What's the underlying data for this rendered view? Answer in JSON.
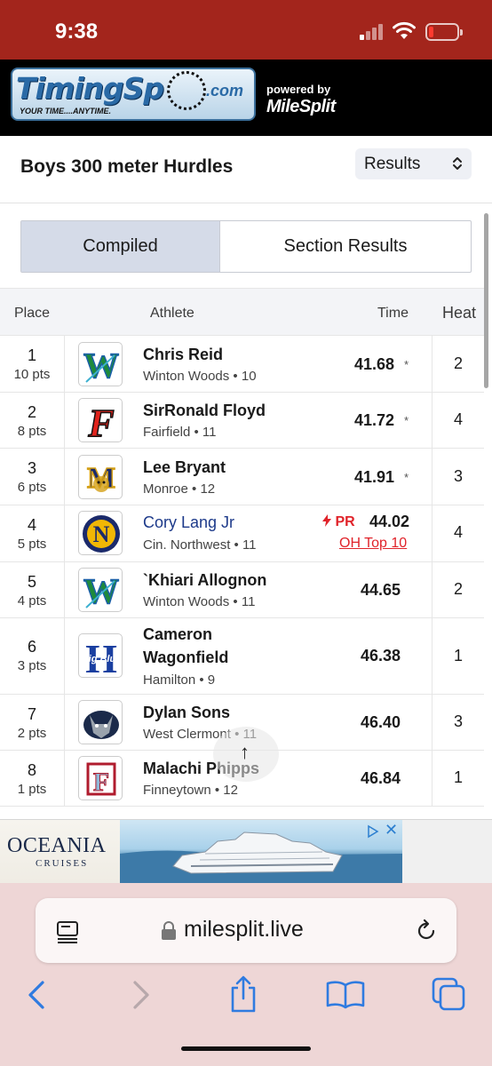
{
  "status": {
    "time": "9:38"
  },
  "header": {
    "logo_text": "TimingSp",
    "logo_com": ".com",
    "logo_tagline": "YOUR TIME....ANYTIME.",
    "powered_by": "powered by",
    "brand": "MileSplit"
  },
  "event": {
    "title": "Boys 300 meter Hurdles",
    "view_select": "Results"
  },
  "tabs": [
    {
      "label": "Compiled"
    },
    {
      "label": "Section Results"
    }
  ],
  "table": {
    "headers": {
      "place": "Place",
      "athlete": "Athlete",
      "time": "Time",
      "heat": "Heat"
    },
    "rows": [
      {
        "place": "1",
        "pts": "10 pts",
        "name": "Chris Reid",
        "school": "Winton Woods • 10",
        "time": "41.68",
        "mark": "*",
        "heat": "2",
        "logo": "winton-woods-logo"
      },
      {
        "place": "2",
        "pts": "8 pts",
        "name": "SirRonald Floyd",
        "school": "Fairfield • 11",
        "time": "41.72",
        "mark": "*",
        "heat": "4",
        "logo": "fairfield-logo"
      },
      {
        "place": "3",
        "pts": "6 pts",
        "name": "Lee Bryant",
        "school": "Monroe • 12",
        "time": "41.91",
        "mark": "*",
        "heat": "3",
        "logo": "monroe-logo"
      },
      {
        "place": "4",
        "pts": "5 pts",
        "name": "Cory Lang Jr",
        "school": "Cin. Northwest • 11",
        "time": "44.02",
        "pr": "PR",
        "rank_link": "OH Top 10",
        "heat": "4",
        "logo": "cin-northwest-logo"
      },
      {
        "place": "5",
        "pts": "4 pts",
        "name": "`Khiari Allognon",
        "school": "Winton Woods • 11",
        "time": "44.65",
        "heat": "2",
        "logo": "winton-woods-logo"
      },
      {
        "place": "6",
        "pts": "3 pts",
        "name_line1": "Cameron",
        "name_line2": "Wagonfield",
        "school": "Hamilton • 9",
        "time": "46.38",
        "heat": "1",
        "logo": "hamilton-logo",
        "logo_text": "Big Blue"
      },
      {
        "place": "7",
        "pts": "2 pts",
        "name": "Dylan Sons",
        "school": "West Clermont • 11",
        "time": "46.40",
        "heat": "3",
        "logo": "west-clermont-logo"
      },
      {
        "place": "8",
        "pts": "1 pts",
        "name": "Malachi Phipps",
        "school": "Finneytown • 12",
        "time": "46.84",
        "heat": "1",
        "logo": "finneytown-logo"
      }
    ]
  },
  "ad": {
    "brand": "OCEANIA",
    "sub": "CRUISES",
    "close": "✕"
  },
  "browser": {
    "url": "milesplit.live"
  },
  "colors": {
    "status_bar": "#a3251c",
    "header": "#000000",
    "accent_red": "#e0232a",
    "link_blue": "#1d3a8a",
    "tab_active": "#d5dbe8",
    "browser_bar": "#eed6d6",
    "ios_blue": "#2f7be0"
  }
}
